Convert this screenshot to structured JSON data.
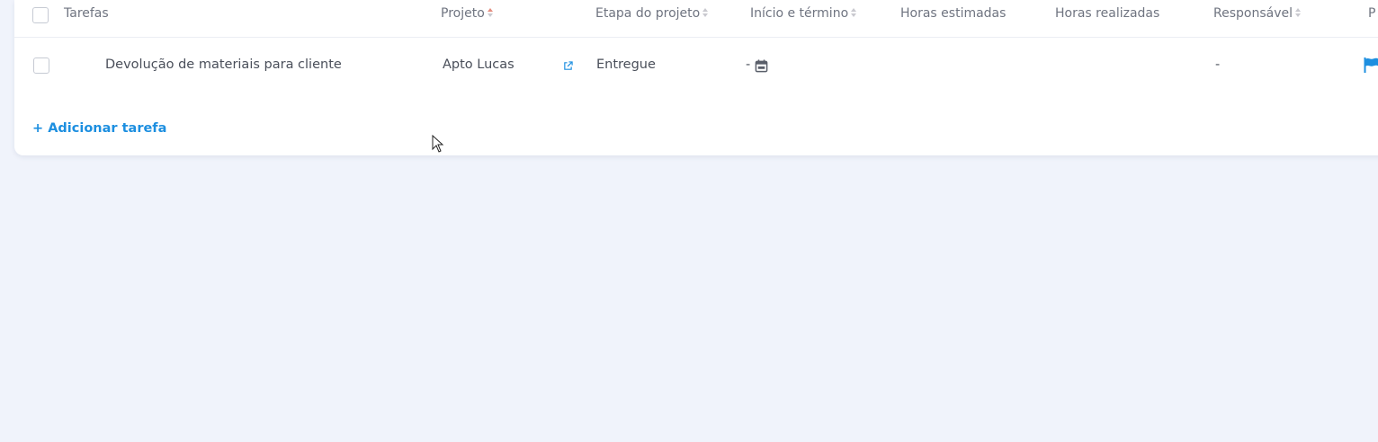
{
  "header": {
    "columns": [
      {
        "label": "Tarefas",
        "sortable": false
      },
      {
        "label": "Projeto",
        "sortable": true
      },
      {
        "label": "Etapa do projeto",
        "sortable": true
      },
      {
        "label": "Início e término",
        "sortable": true
      },
      {
        "label": "Horas estimadas",
        "sortable": false
      },
      {
        "label": "Horas realizadas",
        "sortable": false
      },
      {
        "label": "Responsável",
        "sortable": true
      },
      {
        "label": "P",
        "sortable": false
      }
    ]
  },
  "rows": [
    {
      "task": "Devolução de materiais para cliente",
      "project": "Apto Lucas",
      "stage": "Entregue",
      "dates": "-",
      "estimated_hours": "",
      "actual_hours": "",
      "assignee": "-",
      "priority_icon": "flag-icon"
    }
  ],
  "actions": {
    "add_task_label": "+ Adicionar tarefa"
  },
  "colors": {
    "accent": "#1d8fe0",
    "background": "#f0f3fb",
    "card": "#ffffff",
    "sort_active": "#e58c7e"
  }
}
